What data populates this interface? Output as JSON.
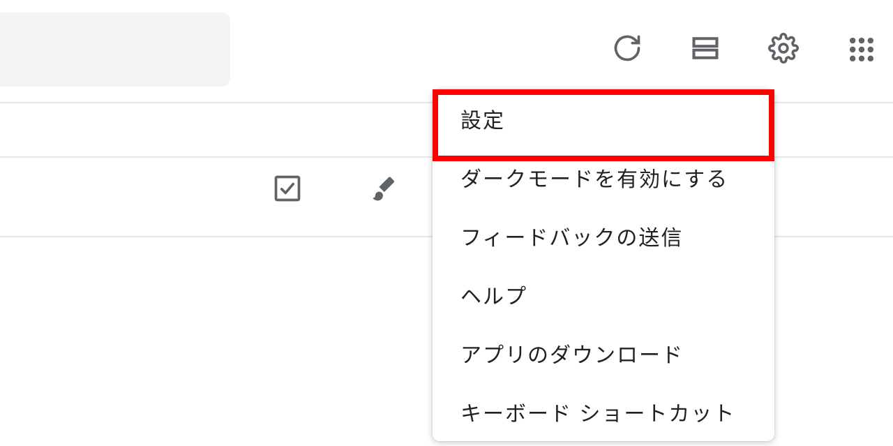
{
  "toolbar": {
    "refresh": "",
    "list_view": "",
    "settings": "",
    "apps": ""
  },
  "note_actions": {
    "checkbox": "",
    "brush": ""
  },
  "settings_menu": {
    "items": [
      "設定",
      "ダークモードを有効にする",
      "フィードバックの送信",
      "ヘルプ",
      "アプリのダウンロード",
      "キーボード ショートカット"
    ]
  },
  "highlighted_index": 0
}
